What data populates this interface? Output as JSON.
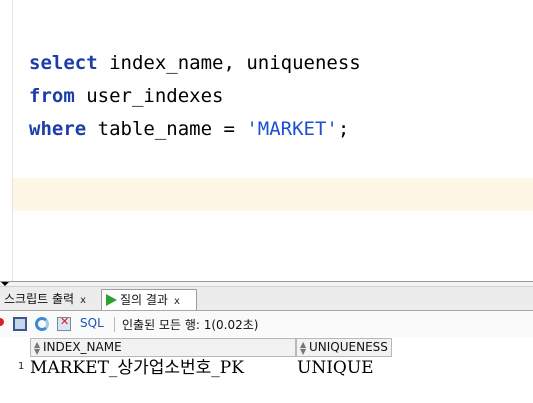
{
  "editor": {
    "line1": {
      "kw": "select",
      "rest": " index_name, uniqueness"
    },
    "line2": {
      "kw": "from",
      "rest": " user_indexes"
    },
    "line3": {
      "kw": "where",
      "mid": " table_name = ",
      "str": "'MARKET'",
      "end": ";"
    }
  },
  "tabs": [
    {
      "label": "스크립트 출력",
      "close": "x"
    },
    {
      "label": "질의 결과",
      "close": "x"
    }
  ],
  "toolbar": {
    "sql_label": "SQL",
    "status": "인출된 모든 행: 1(0.02초)"
  },
  "grid": {
    "columns": [
      "INDEX_NAME",
      "UNIQUENESS"
    ],
    "rows": [
      {
        "num": "1",
        "cells": [
          "MARKET_상가업소번호_PK",
          "UNIQUE"
        ]
      }
    ]
  },
  "colors": {
    "keyword": "#1c3ea6",
    "string": "#1e4fcf",
    "current_line": "#fdf7e4",
    "run_icon": "#2da12d"
  }
}
